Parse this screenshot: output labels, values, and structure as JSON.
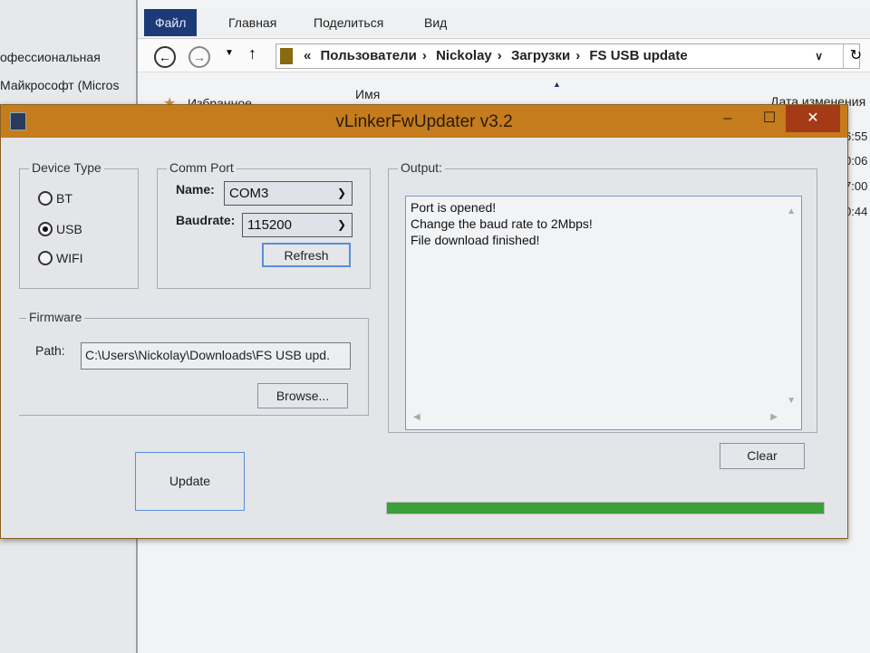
{
  "background": {
    "left_items": [
      "офессиональная",
      "Майкрософт (Micros"
    ]
  },
  "explorer": {
    "ribbon_tabs": [
      "Файл",
      "Главная",
      "Поделиться",
      "Вид"
    ],
    "breadcrumb": [
      "Пользователи",
      "Nickolay",
      "Загрузки",
      "FS USB update"
    ],
    "breadcrumb_prefix": "«",
    "favorites": "Избранное",
    "col_name": "Имя",
    "col_date": "Дата изменения",
    "times": [
      "6:55",
      "0:06",
      "7:00",
      "0:44"
    ]
  },
  "dialog": {
    "title": "vLinkerFwUpdater v3.2",
    "device_type": {
      "label": "Device Type",
      "options": [
        "BT",
        "USB",
        "WIFI"
      ],
      "selected": "USB"
    },
    "comm_port": {
      "label": "Comm Port",
      "name_label": "Name:",
      "name_value": "COM3",
      "baud_label": "Baudrate:",
      "baud_value": "115200",
      "refresh": "Refresh"
    },
    "firmware": {
      "label": "Firmware",
      "path_label": "Path:",
      "path_value": "C:\\Users\\Nickolay\\Downloads\\FS USB upd.",
      "browse": "Browse..."
    },
    "output": {
      "label": "Output:",
      "lines": [
        "Port is opened!",
        "Change the baud rate to 2Mbps!",
        "File download finished!"
      ]
    },
    "clear": "Clear",
    "update": "Update",
    "progress_percent": 100,
    "colors": {
      "titlebar": "#c57c1d",
      "progress": "#3aa03a",
      "close": "#a43a16"
    }
  }
}
